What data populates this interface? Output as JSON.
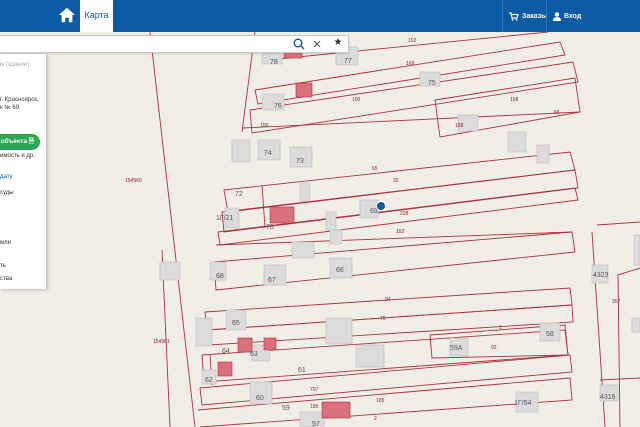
{
  "header": {
    "tab_label": "Карта",
    "orders_label": "Заказы",
    "login_label": "Вход"
  },
  "search": {
    "placeholder": "м (здание)"
  },
  "panel": {
    "address_line1": "г. Красноярск,",
    "address_line2": "к № 69",
    "object_button": "объекта",
    "line_realty": "имость и др.",
    "link_date": "дату",
    "item_1": "суды",
    "item_2": "мли",
    "item_3": "ть",
    "item_4": "ства"
  },
  "map_labels": {
    "p78": "78",
    "p77": "77",
    "p102": "102",
    "p169": "169",
    "p75": "75",
    "p76": "76",
    "p100": "100",
    "p100b": "100",
    "p168": "168",
    "p65a": "65",
    "p168b": "168",
    "p74": "74",
    "p73": "73",
    "p65b": "65",
    "p154960": "154960",
    "p32": "32",
    "p72": "72",
    "p69": "69",
    "p228": "228",
    "p1g21": "1Г/21",
    "p70": "70",
    "p152": "152",
    "p68": "68",
    "p67": "67",
    "p66": "66",
    "p94": "94",
    "p65c": "65",
    "p76b": "76",
    "p1": "1",
    "p58": "58",
    "p154961": "154961",
    "p64": "64",
    "p63": "63",
    "p59a": "59А",
    "p92": "92",
    "p62": "62",
    "p61": "61",
    "p707": "707",
    "p60": "60",
    "p165": "165",
    "p1g54": "1Г/54",
    "p59": "59",
    "p195": "195",
    "p2": "2",
    "p57": "57",
    "p4323": "4323",
    "p357": "357",
    "p4316": "4316"
  },
  "colors": {
    "header_bg": "#0b5aa5",
    "parcel_border": "#b0313e",
    "building_red": "#d9707b",
    "building_grey": "#dcdcdc",
    "map_bg": "#f1eee8",
    "button_green": "#2fa653"
  }
}
